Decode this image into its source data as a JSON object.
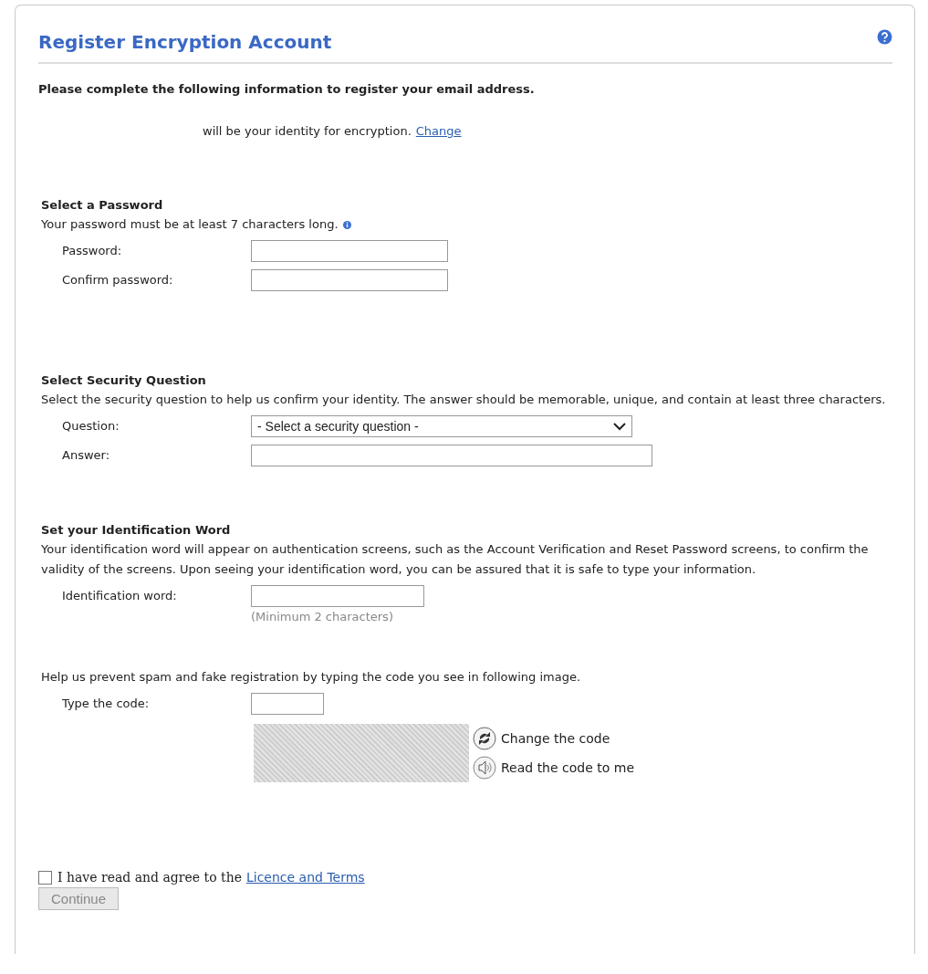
{
  "title": "Register Encryption Account",
  "intro": "Please complete the following information to register your email address.",
  "identity": {
    "text": "will be your identity for encryption.",
    "link": "Change"
  },
  "sections": [
    {
      "heading": "Select a Password",
      "description": "Your password must be at least 7 characters long.",
      "info": true,
      "fields": [
        {
          "label": "Password:",
          "kind": "text"
        },
        {
          "label": "Confirm password:",
          "kind": "text"
        }
      ]
    },
    {
      "heading": "Select Security Question",
      "description": "Select the security question to help us confirm your identity. The answer should be memorable, unique, and contain at least three characters.",
      "info": false,
      "fields": [
        {
          "label": "Question:",
          "kind": "select",
          "value": "- Select a security question -"
        },
        {
          "label": "Answer:",
          "kind": "text"
        }
      ]
    },
    {
      "heading": "Set your Identification Word",
      "description": "Your identification word will appear on authentication screens, such as the Account Verification and Reset Password screens, to confirm the validity of the screens. Upon seeing your identification word, you can be assured that it is safe to type your information.",
      "info": false,
      "fields": [
        {
          "label": "Identification word:",
          "kind": "text",
          "note": "(Minimum 2 characters)"
        }
      ]
    }
  ],
  "captcha": {
    "description": "Help us prevent spam and fake registration by typing the code you see in following image.",
    "fields": [
      {
        "label": "Type the code:",
        "kind": "text"
      }
    ],
    "actions": [
      {
        "label": "Change the code",
        "kind": "refresh"
      },
      {
        "label": "Read the code to me",
        "kind": "audio"
      }
    ]
  },
  "agreement": {
    "checked": false,
    "text": "I have read and agree to the",
    "link": "Licence and Terms"
  },
  "continue": {
    "label": "Continue",
    "disabled": true
  }
}
